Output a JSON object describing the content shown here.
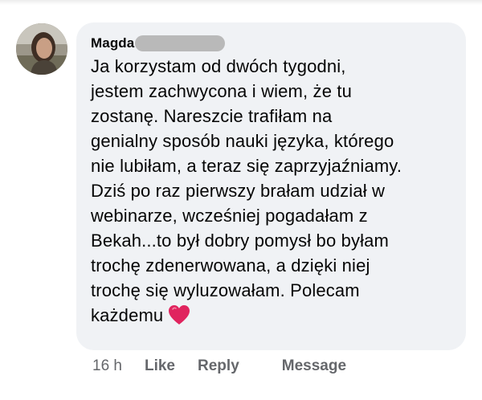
{
  "comment": {
    "author": "Magda",
    "avatar_alt": "profile-photo",
    "lines": [
      "Ja korzystam od dwóch tygodni,",
      "jestem zachwycona i wiem, że tu",
      "zostanę. Nareszcie trafiłam na",
      "genialny sposób nauki języka, którego",
      "nie lubiłam, a teraz się zaprzyjaźniamy.",
      "Dziś po raz pierwszy brałam udział w",
      "webinarze, wcześniej pogadałam z",
      "Bekah...to był dobry pomysł bo byłam",
      "trochę zdenerwowana, a dzięki niej",
      "trochę się wyluzowałam. Polecam",
      "każdemu"
    ],
    "emoji": "red-heart-icon"
  },
  "actions": {
    "time": "16 h",
    "like": "Like",
    "reply": "Reply",
    "message": "Message"
  },
  "colors": {
    "bubble": "#f0f2f5",
    "text": "#050505",
    "secondary": "#65676b",
    "heart": "#e0245e",
    "redaction": "#b9b9b9"
  }
}
